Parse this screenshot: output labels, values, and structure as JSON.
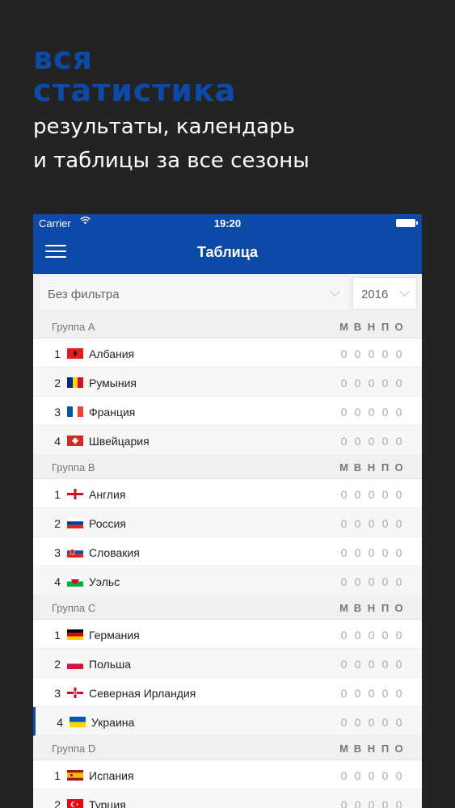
{
  "promo": {
    "title_line1": "вся",
    "title_line2": "статистика",
    "sub_line1": "результаты, календарь",
    "sub_line2": "и таблицы за все сезоны"
  },
  "status": {
    "carrier": "Carrier",
    "time": "19:20"
  },
  "nav": {
    "title": "Таблица"
  },
  "filters": {
    "filter_value": "Без фильтра",
    "season_value": "2016"
  },
  "stat_headers": [
    "М",
    "В",
    "Н",
    "П",
    "О"
  ],
  "groups": [
    {
      "name": "Группа A",
      "teams": [
        {
          "pos": "1",
          "name": "Албания",
          "flag": "albania-flag",
          "stats": [
            "0",
            "0",
            "0",
            "0",
            "0"
          ]
        },
        {
          "pos": "2",
          "name": "Румыния",
          "flag": "romania-flag",
          "stats": [
            "0",
            "0",
            "0",
            "0",
            "0"
          ]
        },
        {
          "pos": "3",
          "name": "Франция",
          "flag": "france-flag",
          "stats": [
            "0",
            "0",
            "0",
            "0",
            "0"
          ]
        },
        {
          "pos": "4",
          "name": "Швейцария",
          "flag": "switzerland-flag",
          "stats": [
            "0",
            "0",
            "0",
            "0",
            "0"
          ]
        }
      ]
    },
    {
      "name": "Группа B",
      "teams": [
        {
          "pos": "1",
          "name": "Англия",
          "flag": "england-flag",
          "stats": [
            "0",
            "0",
            "0",
            "0",
            "0"
          ]
        },
        {
          "pos": "2",
          "name": "Россия",
          "flag": "russia-flag",
          "stats": [
            "0",
            "0",
            "0",
            "0",
            "0"
          ]
        },
        {
          "pos": "3",
          "name": "Словакия",
          "flag": "slovakia-flag",
          "stats": [
            "0",
            "0",
            "0",
            "0",
            "0"
          ]
        },
        {
          "pos": "4",
          "name": "Уэльс",
          "flag": "wales-flag",
          "stats": [
            "0",
            "0",
            "0",
            "0",
            "0"
          ]
        }
      ]
    },
    {
      "name": "Группа C",
      "teams": [
        {
          "pos": "1",
          "name": "Германия",
          "flag": "germany-flag",
          "stats": [
            "0",
            "0",
            "0",
            "0",
            "0"
          ]
        },
        {
          "pos": "2",
          "name": "Польша",
          "flag": "poland-flag",
          "stats": [
            "0",
            "0",
            "0",
            "0",
            "0"
          ]
        },
        {
          "pos": "3",
          "name": "Северная Ирландия",
          "flag": "northern-ireland-flag",
          "stats": [
            "0",
            "0",
            "0",
            "0",
            "0"
          ]
        },
        {
          "pos": "4",
          "name": "Украина",
          "flag": "ukraine-flag",
          "stats": [
            "0",
            "0",
            "0",
            "0",
            "0"
          ]
        }
      ]
    },
    {
      "name": "Группа D",
      "teams": [
        {
          "pos": "1",
          "name": "Испания",
          "flag": "spain-flag",
          "stats": [
            "0",
            "0",
            "0",
            "0",
            "0"
          ]
        },
        {
          "pos": "2",
          "name": "Турция",
          "flag": "turkey-flag",
          "stats": [
            "0",
            "0",
            "0",
            "0",
            "0"
          ]
        }
      ]
    }
  ],
  "colors": {
    "brand": "#0d4aa8",
    "background": "#232323"
  }
}
